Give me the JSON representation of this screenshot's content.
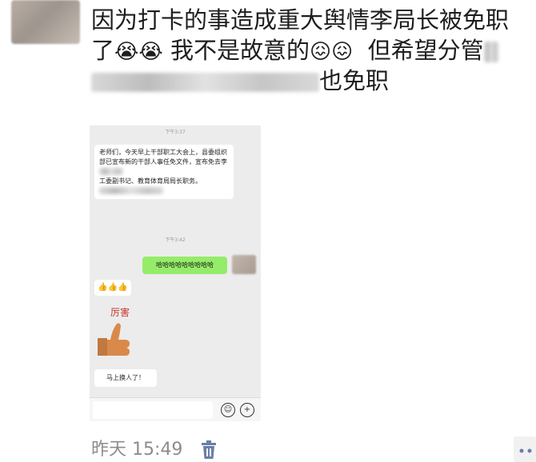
{
  "post": {
    "line1": "因为打卡的事造成重大舆情李局长被免职",
    "line2_a": "了",
    "line2_emoji": "😭😭",
    "line2_b": "我不是故意的",
    "line2_emoji2": "😖😖",
    "line2_c": "但希望分管",
    "line3_end": "也免职"
  },
  "screenshot": {
    "time1": "下午3:37",
    "message1": "老师们，今天早上干部职工大会上，县委组织部已宣布新的干部人事任免文件，宣布免去李",
    "message1_b": "工委副书记、教育体育局局长职务。",
    "time2": "下午3:42",
    "message2": "哈哈哈哈哈哈哈哈哈",
    "message3": "👍👍👍",
    "sticker_text": "厉害",
    "message4": "马上换人了！",
    "emoji_button": "☺",
    "plus_button": "+"
  },
  "footer": {
    "time": "昨天 15:49"
  },
  "colors": {
    "green_bubble": "#95ec69",
    "chat_bg": "#ececec",
    "sticker_red": "#c9342a"
  }
}
